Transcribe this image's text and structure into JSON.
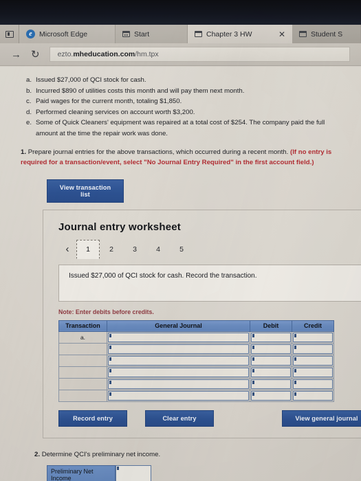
{
  "browser": {
    "tabs_button_icon": "panel-toggle-icon",
    "brand_tab": {
      "label": "Microsoft Edge",
      "icon": "edge-logo-icon"
    },
    "start_tab": {
      "label": "Start",
      "icon": "window-icon"
    },
    "active_tab": {
      "label": "Chapter 3 HW",
      "icon": "window-icon",
      "close": "✕"
    },
    "trailing_tab": {
      "label": "Student S",
      "icon": "window-icon"
    },
    "forward_icon": "→",
    "refresh_icon": "↻",
    "url_prefix": "ezto.",
    "url_domain": "mheducation.com",
    "url_path": "/hm.tpx"
  },
  "transactions": [
    {
      "letter": "a.",
      "text": "Issued $27,000 of QCI stock for cash."
    },
    {
      "letter": "b.",
      "text": "Incurred $890 of utilities costs this month and will pay them next month."
    },
    {
      "letter": "c.",
      "text": "Paid wages for the current month, totaling $1,850."
    },
    {
      "letter": "d.",
      "text": "Performed cleaning services on account worth $3,200."
    },
    {
      "letter": "e.",
      "text": "Some of Quick Cleaners' equipment was repaired at a total cost of $254. The company paid the full amount at the time the repair work was done."
    }
  ],
  "requirement1": {
    "number": "1.",
    "black_text": "Prepare journal entries for the above transactions, which occurred during a recent month.",
    "red_text": "(If no entry is required for a transaction/event, select \"No Journal Entry Required\" in the first account field.)"
  },
  "view_transaction_list_label": "View transaction list",
  "worksheet": {
    "title": "Journal entry worksheet",
    "prev_arrow": "‹",
    "next_arrow": "›",
    "pages": [
      "1",
      "2",
      "3",
      "4",
      "5"
    ],
    "active_page": "1",
    "prompt": "Issued $27,000 of QCI stock for cash. Record the transaction.",
    "note": "Note: Enter debits before credits.",
    "table": {
      "headers": [
        "Transaction",
        "General Journal",
        "Debit",
        "Credit"
      ],
      "rows": [
        {
          "transaction": "a.",
          "general_journal": "",
          "debit": "",
          "credit": ""
        },
        {
          "transaction": "",
          "general_journal": "",
          "debit": "",
          "credit": ""
        },
        {
          "transaction": "",
          "general_journal": "",
          "debit": "",
          "credit": ""
        },
        {
          "transaction": "",
          "general_journal": "",
          "debit": "",
          "credit": ""
        },
        {
          "transaction": "",
          "general_journal": "",
          "debit": "",
          "credit": ""
        },
        {
          "transaction": "",
          "general_journal": "",
          "debit": "",
          "credit": ""
        }
      ]
    },
    "buttons": {
      "record": "Record entry",
      "clear": "Clear entry",
      "view_general_journal": "View general journal"
    }
  },
  "requirement2": {
    "number": "2.",
    "text": "Determine QCI's preliminary net income.",
    "field_label": "Preliminary Net Income",
    "field_value": ""
  },
  "colors": {
    "button_blue": "#2d5292",
    "table_header_blue": "#6a8cc0",
    "red_text": "#b32d33",
    "note_red": "#8f3b42",
    "page_background": "#dcd7cf"
  }
}
